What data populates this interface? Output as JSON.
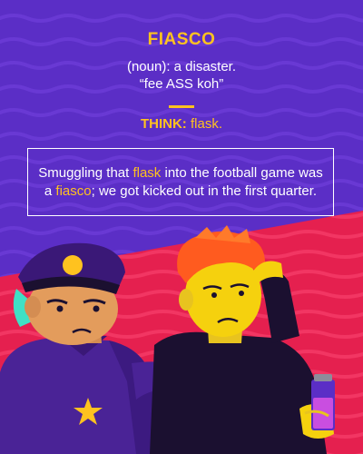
{
  "colors": {
    "background_purple": "#5b2ec6",
    "background_red": "#e5204f",
    "accent_yellow": "#ffc21f",
    "text_white": "#ffffff"
  },
  "word": "FIASCO",
  "definition_line1": "(noun): a disaster.",
  "definition_line2": "“fee ASS koh”",
  "think": {
    "prefix": "THINK:",
    "keyword": "flask."
  },
  "sentence": {
    "part1": "Smuggling that ",
    "highlight1": "flask",
    "part2": " into the football game was a ",
    "highlight2": "fiasco",
    "part3": "; we got kicked out in the first quarter."
  },
  "illustration": {
    "characters": [
      "police-officer",
      "red-haired-man"
    ],
    "props": [
      "police-cap",
      "star-badge",
      "flask"
    ]
  }
}
